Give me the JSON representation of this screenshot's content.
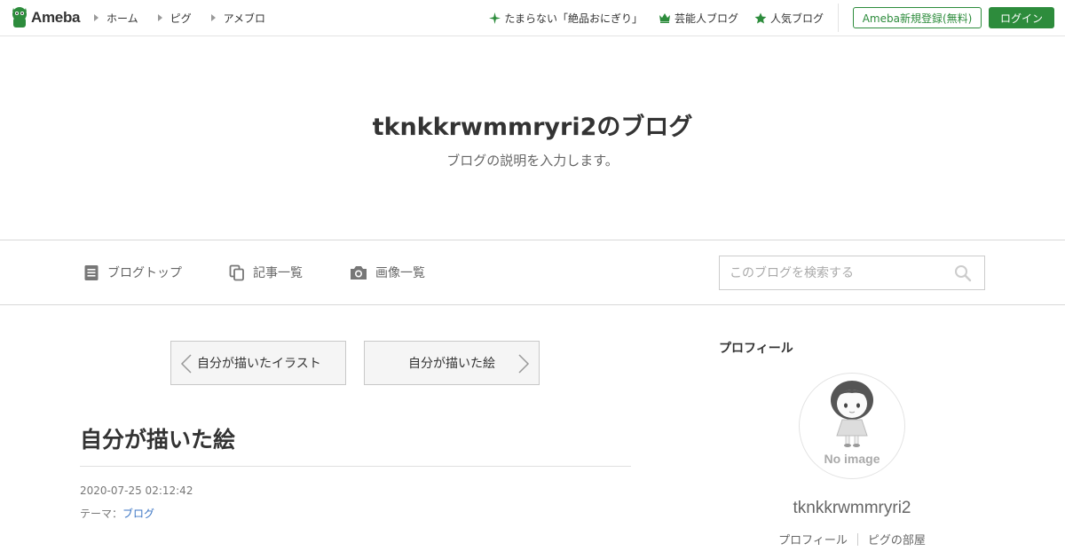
{
  "topbar": {
    "logo_text": "Ameba",
    "nav": [
      {
        "label": "ホーム"
      },
      {
        "label": "ピグ"
      },
      {
        "label": "アメブロ"
      }
    ],
    "links": [
      {
        "label": "たまらない「絶品おにぎり」",
        "icon": "sparkle-icon"
      },
      {
        "label": "芸能人ブログ",
        "icon": "crown-icon"
      },
      {
        "label": "人気ブログ",
        "icon": "star-icon"
      }
    ],
    "register_label": "Ameba新規登録(無料)",
    "login_label": "ログイン",
    "accent_color": "#2d8c3c"
  },
  "blog": {
    "title": "tknkkrwmmryri2のブログ",
    "description": "ブログの説明を入力します。"
  },
  "blog_nav": {
    "items": [
      {
        "label": "ブログトップ",
        "icon": "document-icon"
      },
      {
        "label": "記事一覧",
        "icon": "copy-icon"
      },
      {
        "label": "画像一覧",
        "icon": "camera-icon"
      }
    ],
    "search_placeholder": "このブログを検索する"
  },
  "pager": {
    "prev_label": "自分が描いたイラスト",
    "next_label": "自分が描いた絵"
  },
  "article": {
    "title": "自分が描いた絵",
    "date": "2020-07-25 02:12:42",
    "theme_label": "テーマ：",
    "theme_value": "ブログ"
  },
  "sidebar": {
    "heading": "プロフィール",
    "avatar_text": "No image",
    "name": "tknkkrwmmryri2",
    "links": [
      {
        "label": "プロフィール"
      },
      {
        "label": "ピグの部屋"
      }
    ]
  }
}
